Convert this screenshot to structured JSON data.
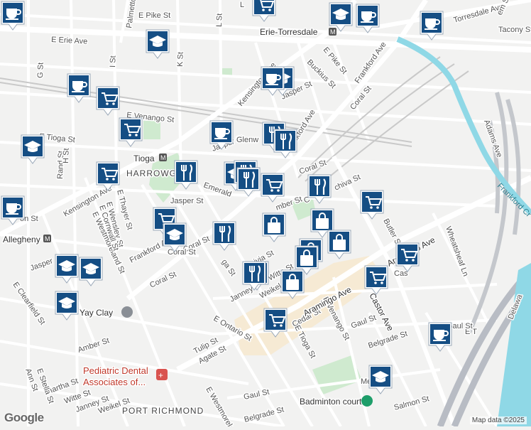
{
  "map": {
    "attribution": "Map data ©2025",
    "logo": "Google",
    "areas": {
      "harrowgate": "HARROWG",
      "port_richmond": "PORT RICHMOND"
    },
    "stations": {
      "erie_torresdale": "Erie-Torresdale",
      "tioga": "Tioga",
      "allegheny": "Allegheny"
    },
    "places": {
      "yay_clay": "Yay Clay",
      "pediatric_dental_1": "Pediatric Dental",
      "pediatric_dental_2": "Associates of...",
      "badminton": "Badminton court"
    },
    "roads": {
      "e_erie_ave": "E Erie Ave",
      "torresdale_ave": "Torresdale Ave",
      "tacony_st": "Tacony St",
      "e_pike_st_n": "E Pike St",
      "e_pike_st": "E Pike St",
      "buckius_st": "Buckius St",
      "frankford_ave_ne": "Frankford Ave",
      "frankford_ave_mid": "Frankford Ave",
      "frankford_ave_sw": "Frankford Ave",
      "kensington_ave_n": "Kensington Ave",
      "kensington_ave_w": "Kensington Ave",
      "e_venango_st": "E Venango St",
      "e_tioga_st": "E Tioga St",
      "jasper_st_n": "Jasper St",
      "jasper_st_mid": "Jasper St",
      "coral_st_ne": "Coral St",
      "coral_st_mid": "Coral St",
      "coral_st_e": "Coral St",
      "coral_st_w": "Coral St",
      "glenwood": "Glenw",
      "emerald_st": "Emerald",
      "amber_st": "mber St",
      "amber_st_sw": "Amber St",
      "cambria_st": "C",
      "janney_st": "Janney",
      "weikel_st": "Weikel St",
      "witte_st": "Witte St",
      "kip_st": "S",
      "e_ontario_st": "E Ontario St",
      "tulip_st": "Tulip St",
      "agate_st": "Agate St",
      "cedar_st": "Cedar St",
      "e_venango_st_s": "E Venango St",
      "e_tioga_st_s": "E Tioga St",
      "aramingo_ave": "Aramingo Ave",
      "aramingo_ave_n": "Aramingo Ave",
      "castor_ave": "Castor Ave",
      "butler_st": "Butler St",
      "wheatsheaf_ln": "Wheatsheaf Ln",
      "adams_ave": "Adams Ave",
      "gaul_st": "Gaul St",
      "gaul_st_s": "Gaul St",
      "belgrade_st": "Belgrade St",
      "belgrade_st_s": "Belgrade St",
      "salmon_st": "Salmon St",
      "e_thayer_st": "E Thayer St",
      "wensley_st": "E Wensley St",
      "e_westmoreland_st": "E Westmoreland St",
      "e_westmoreland_st_s": "E Westmoreland",
      "e_clearfield_st": "E Clearfield St",
      "e_cornwall_st": "E Cornwall St",
      "rand_st": "Rand St",
      "h_st": "H St",
      "g_st": "G St",
      "i_st": "I St",
      "k_st": "K St",
      "l_st": "L St",
      "palmetto_st": "Palmetto St",
      "martha_st": "Martha St",
      "witte_st_sw": "Witte St",
      "janney_st_sw": "Janney St",
      "weikel_st_sw": "Weikel St",
      "ann_st": "Ann St",
      "e_stella_st": "E Stella St",
      "delaware": "Delawa",
      "frankford_creek": "Frankford Cr",
      "e_tioga_st_e": "E T",
      "jasper_w": "Jasper",
      "on_st": "on St",
      "ga_st": "ga St",
      "ivia_st": "ivia St",
      "chiva_st": "chiva St",
      "e_jasper": "Jasper St",
      "coral_west": "Coral St",
      "mifflin": "Me",
      "gaul_near": "Gaul St",
      "em_st": "em St",
      "cas": "Cas",
      "lve": "L"
    },
    "markers": [
      {
        "type": "shopping-cart",
        "label": "grocery"
      },
      {
        "type": "school-cap",
        "label": "school"
      },
      {
        "type": "coffee-cup",
        "label": "cafe"
      },
      {
        "type": "coffee-cup",
        "label": "cafe"
      },
      {
        "type": "school-cap",
        "label": "school"
      },
      {
        "type": "coffee-cup",
        "label": "cafe"
      },
      {
        "type": "school-cap",
        "label": "school"
      },
      {
        "type": "shopping-cart",
        "label": "grocery"
      },
      {
        "type": "coffee-cup",
        "label": "cafe"
      },
      {
        "type": "coffee-cup",
        "label": "cafe"
      },
      {
        "type": "shopping-cart",
        "label": "grocery"
      },
      {
        "type": "coffee-cup",
        "label": "cafe"
      },
      {
        "type": "fork-knife",
        "label": "restaurant"
      },
      {
        "type": "fork-knife",
        "label": "restaurant"
      },
      {
        "type": "school-cap",
        "label": "school"
      },
      {
        "type": "shopping-cart",
        "label": "grocery"
      },
      {
        "type": "fork-knife",
        "label": "restaurant"
      },
      {
        "type": "school-cap",
        "label": "school"
      },
      {
        "type": "fork-knife",
        "label": "restaurant"
      },
      {
        "type": "fork-knife",
        "label": "restaurant"
      },
      {
        "type": "shopping-cart",
        "label": "grocery"
      },
      {
        "type": "coffee-cup",
        "label": "cafe"
      },
      {
        "type": "shopping-cart",
        "label": "grocery"
      },
      {
        "type": "school-cap",
        "label": "school"
      },
      {
        "type": "fork-knife",
        "label": "restaurant"
      },
      {
        "type": "fork-knife",
        "label": "restaurant"
      },
      {
        "type": "shopping-bag",
        "label": "store"
      },
      {
        "type": "shopping-bag",
        "label": "store"
      },
      {
        "type": "shopping-cart",
        "label": "grocery"
      },
      {
        "type": "fork-knife",
        "label": "restaurant"
      },
      {
        "type": "shopping-bag",
        "label": "store"
      },
      {
        "type": "shopping-cart",
        "label": "grocery"
      },
      {
        "type": "shopping-bag",
        "label": "store"
      },
      {
        "type": "shopping-bag",
        "label": "store"
      },
      {
        "type": "shopping-bag",
        "label": "store"
      },
      {
        "type": "fork-knife",
        "label": "restaurant"
      },
      {
        "type": "school-cap",
        "label": "school"
      },
      {
        "type": "school-cap",
        "label": "school"
      },
      {
        "type": "school-cap",
        "label": "school"
      },
      {
        "type": "shopping-cart",
        "label": "grocery"
      },
      {
        "type": "shopping-cart",
        "label": "grocery"
      },
      {
        "type": "shopping-cart",
        "label": "grocery"
      },
      {
        "type": "coffee-cup",
        "label": "cafe"
      },
      {
        "type": "school-cap",
        "label": "school"
      }
    ],
    "colors": {
      "marker": "#154e84",
      "water": "#8fd8e6",
      "park": "#cfeacf",
      "commercial": "#f6ead4",
      "road": "#ffffff",
      "rail": "#c9c9c9",
      "highway": "#b8bcc4"
    }
  }
}
